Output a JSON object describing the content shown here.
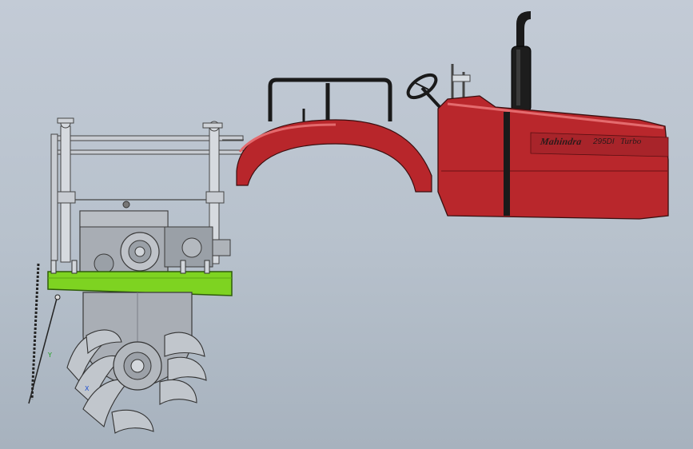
{
  "hood": {
    "brand": "Mahindra",
    "model": "295DI",
    "variant": "Turbo"
  },
  "triad": {
    "y_label": "Y",
    "x_label": "X"
  },
  "colors": {
    "background": "#b9c3ce",
    "body_red": "#b8262b",
    "tire_black": "#1b1b1b",
    "rim_red": "#c4252c",
    "mount_green": "#7ed321",
    "implement_gray": "#9ea3aa"
  }
}
